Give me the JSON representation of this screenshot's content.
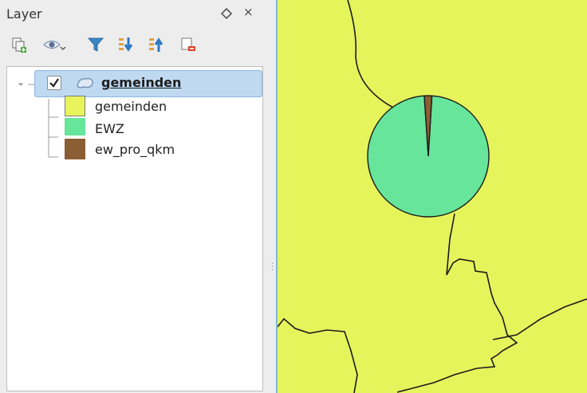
{
  "dock": {
    "title": "Layer",
    "float_icon": "diamond-float-icon",
    "close_label": "×"
  },
  "toolbar": {
    "icons": [
      "add-group-icon",
      "visibility-eye-icon",
      "filter-icon",
      "expand-all-icon",
      "collapse-all-icon",
      "remove-layer-icon"
    ]
  },
  "layer_tree": {
    "expander": "⌄",
    "checked": true,
    "layer_icon": "polygon-layer-icon",
    "layer_name": "gemeinden",
    "legend": [
      {
        "label": "gemeinden",
        "color": "#e8f45c"
      },
      {
        "label": "EWZ",
        "color": "#66e59b"
      },
      {
        "label": "ew_pro_qkm",
        "color": "#8b5e34"
      }
    ]
  },
  "map": {
    "background_color": "#e6f45c",
    "pie_colors": [
      "#66e59b",
      "#8b5e34"
    ],
    "pie_values": [
      0.98,
      0.02
    ]
  }
}
